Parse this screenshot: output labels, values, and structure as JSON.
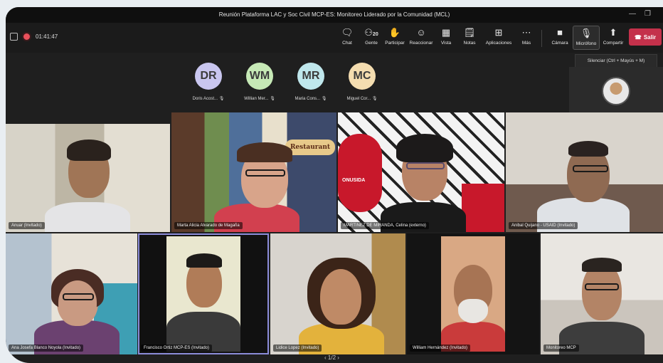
{
  "window": {
    "title": "Reunión Plataforma LAC y Soc Civil MCP-ES: Monitoreo Liderado por la Comunidad (MCL)",
    "minimize_icon": "minimize-icon",
    "restore_icon": "restore-icon"
  },
  "toolbar": {
    "timer": "01:41:47",
    "items": [
      {
        "label": "Chat",
        "icon": "chat-icon"
      },
      {
        "label": "Gente",
        "count": "20",
        "icon": "people-icon"
      },
      {
        "label": "Participar",
        "icon": "raise-hand-icon"
      },
      {
        "label": "Reaccionar",
        "icon": "react-icon"
      },
      {
        "label": "Vista",
        "icon": "view-icon"
      },
      {
        "label": "Notas",
        "icon": "notes-icon"
      },
      {
        "label": "Aplicaciones",
        "icon": "apps-icon"
      },
      {
        "label": "Más",
        "icon": "more-icon"
      },
      {
        "label": "Cámara",
        "icon": "camera-icon"
      },
      {
        "label": "Micrófono",
        "icon": "mic-icon"
      },
      {
        "label": "Compartir",
        "icon": "share-icon"
      }
    ],
    "leave_label": "Salir",
    "colors": {
      "leave": "#c4314b",
      "recording": "#e8505b"
    }
  },
  "tooltip": "Silenciar (Ctrl + Mayús + M)",
  "avatars": [
    {
      "initials": "DR",
      "name": "Doris Acost...",
      "color": "#c9c6ef"
    },
    {
      "initials": "WM",
      "name": "Willian Mer...",
      "color": "#c6e9b6"
    },
    {
      "initials": "MR",
      "name": "Maria Cons...",
      "color": "#bfe7ec"
    },
    {
      "initials": "MC",
      "name": "Miguel Cor...",
      "color": "#f4ddb0"
    }
  ],
  "tiles_row1": [
    {
      "name": "Anuar (Invitado)"
    },
    {
      "name": "Marta Alicia Alvarado de Magaña"
    },
    {
      "name": "MARTINEZ DE MIRANDA, Celina (externo)"
    },
    {
      "name": "Anibal Quijano - USAID (Invitado)"
    }
  ],
  "tiles_row2": [
    {
      "name": "Ana Josefa Blanco Noyola (Invitado)"
    },
    {
      "name": "Francisco Ortiz MCP-ES (Invitado)"
    },
    {
      "name": "Lidice Lopez (Invitado)"
    },
    {
      "name": "William Hernández (Invitado)"
    },
    {
      "name": "Monitoreo MCP"
    }
  ],
  "background_text": {
    "restaurant_sign": "Restaurant",
    "onusida": "ONUSIDA"
  },
  "pager": "1/2"
}
